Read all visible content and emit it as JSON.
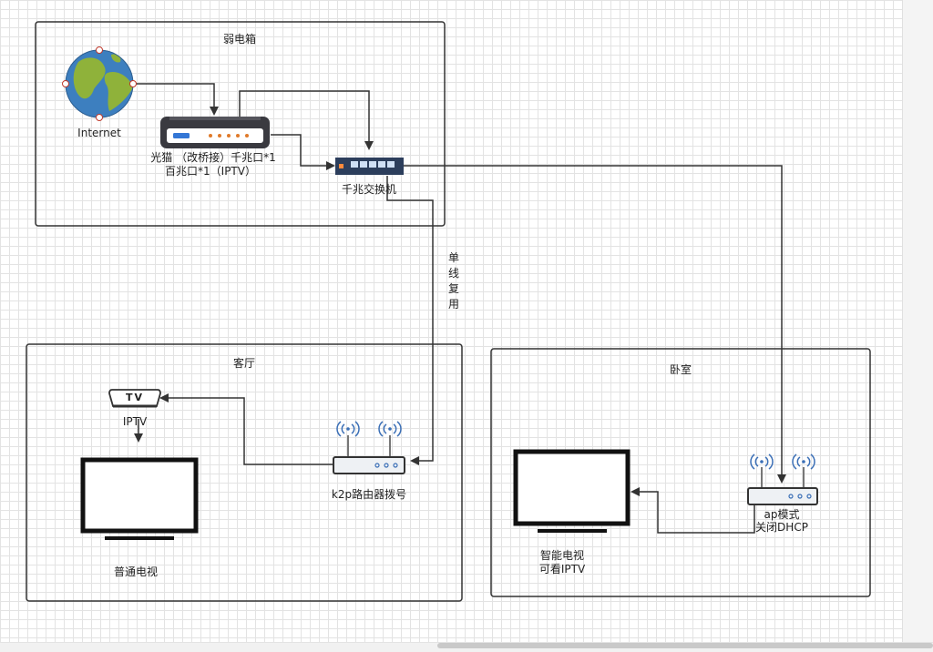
{
  "groups": {
    "weak_box": "弱电箱",
    "living_room": "客厅",
    "bedroom": "卧室"
  },
  "nodes": {
    "internet": "Internet",
    "modem_line1": "光猫 （改桥接）千兆口*1",
    "modem_line2": "百兆口*1（IPTV）",
    "switch": "千兆交换机",
    "router": "k2p路由器拨号",
    "iptv_box_badge": "TV",
    "iptv_box_label": "IPTV",
    "normal_tv": "普通电视",
    "ap_line1": "ap模式",
    "ap_line2": "关闭DHCP",
    "smart_tv_line1": "智能电视",
    "smart_tv_line2": "可看IPTV"
  },
  "edges": {
    "single_line_multiplex": "单线复用"
  },
  "icons": {
    "globe": "globe-icon",
    "modem": "modem-icon",
    "switch": "switch-icon",
    "router": "wireless-router-icon",
    "ap": "wireless-access-point-icon",
    "iptv": "iptv-box-icon",
    "tv": "tv-monitor-icon"
  },
  "colors": {
    "line": "#333333",
    "ocean": "#3d7fbf",
    "land": "#8fb23a",
    "modem_body": "#3a3a40",
    "switch_body": "#2c3e5c",
    "wifi": "#3b6fb6"
  }
}
